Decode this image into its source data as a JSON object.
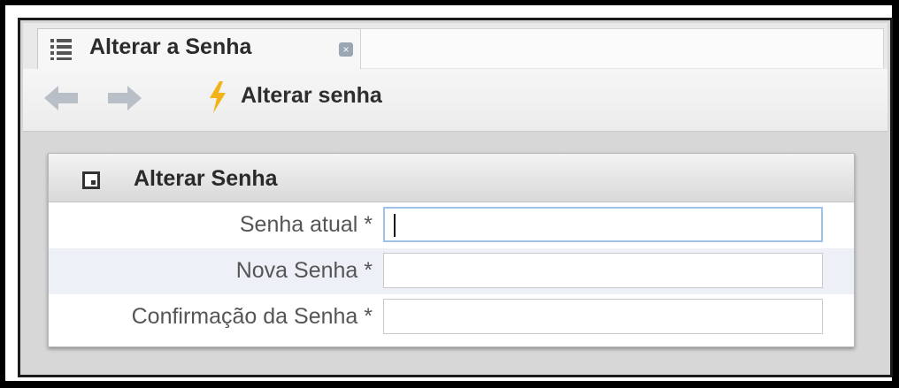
{
  "tab": {
    "title": "Alterar a Senha",
    "icon": "list-icon",
    "close_icon": "close-icon"
  },
  "toolbar": {
    "back_icon": "arrow-left-icon",
    "forward_icon": "arrow-right-icon",
    "action_icon": "lightning-bolt-icon",
    "action_label": "Alterar senha"
  },
  "panel": {
    "title": "Alterar Senha",
    "icon": "window-icon",
    "fields": [
      {
        "label": "Senha atual *",
        "value": "",
        "focused": true
      },
      {
        "label": "Nova Senha *",
        "value": ""
      },
      {
        "label": "Confirmação da Senha *",
        "value": ""
      }
    ]
  },
  "colors": {
    "bolt": "#f2b31a",
    "arrow": "#b9bfc6",
    "focus_border": "#9ec3e6",
    "alt_row": "#edf0f7"
  }
}
